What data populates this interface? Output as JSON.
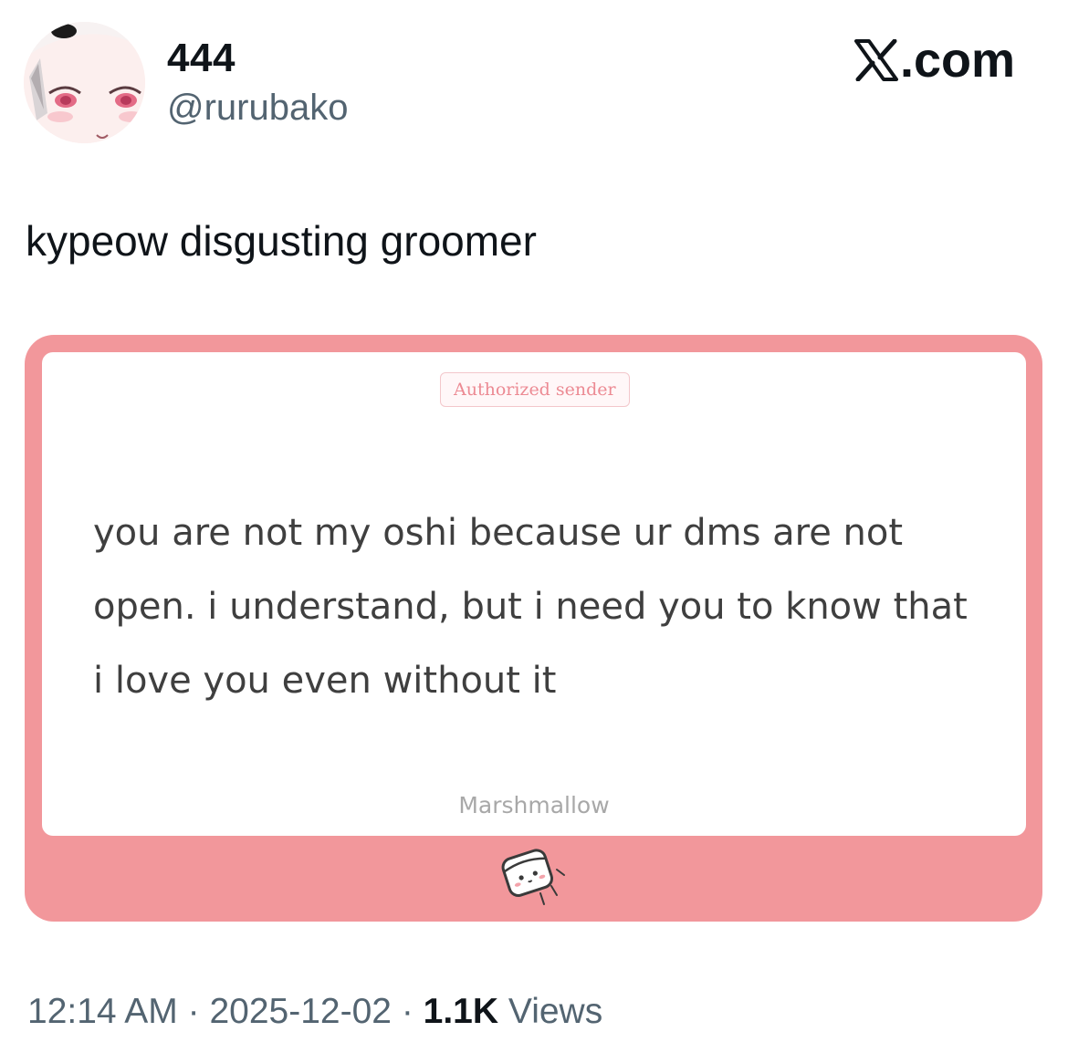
{
  "author": {
    "display_name": "444",
    "handle": "@rurubako"
  },
  "brand": {
    "label": ".com"
  },
  "tweet": {
    "text": "kypeow disgusting groomer"
  },
  "card": {
    "badge": "Authorized sender",
    "message": "you are not my oshi because ur dms are not open. i understand, but i need you to know that i love you even without it",
    "footer_label": "Marshmallow",
    "frame_color": "#f2979b"
  },
  "meta": {
    "time": "12:14 AM",
    "separator": "·",
    "date": "2025-12-02",
    "views_count": "1.1K",
    "views_label": "Views"
  },
  "icons": {
    "avatar": "anime-girl-avatar",
    "brand": "x-logo-icon",
    "card_mascot": "marshmallow-icon"
  }
}
